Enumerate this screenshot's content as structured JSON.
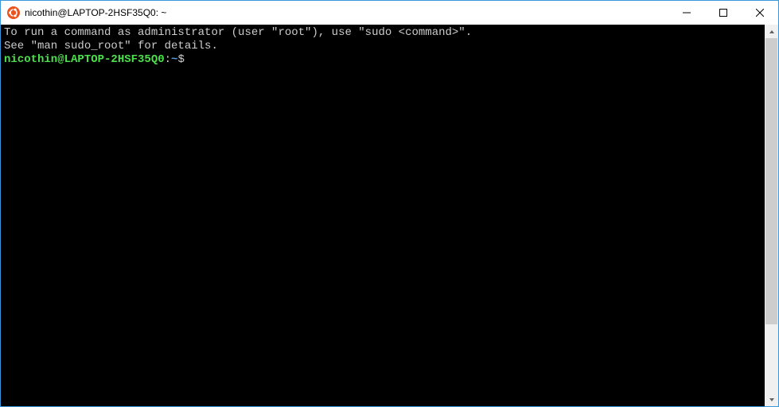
{
  "window": {
    "title": "nicothin@LAPTOP-2HSF35Q0: ~"
  },
  "terminal": {
    "line1": "To run a command as administrator (user \"root\"), use \"sudo <command>\".",
    "line2": "See \"man sudo_root\" for details.",
    "blank": "",
    "prompt": {
      "user_host": "nicothin@LAPTOP-2HSF35Q0",
      "sep": ":",
      "path": "~",
      "symbol": "$"
    }
  }
}
